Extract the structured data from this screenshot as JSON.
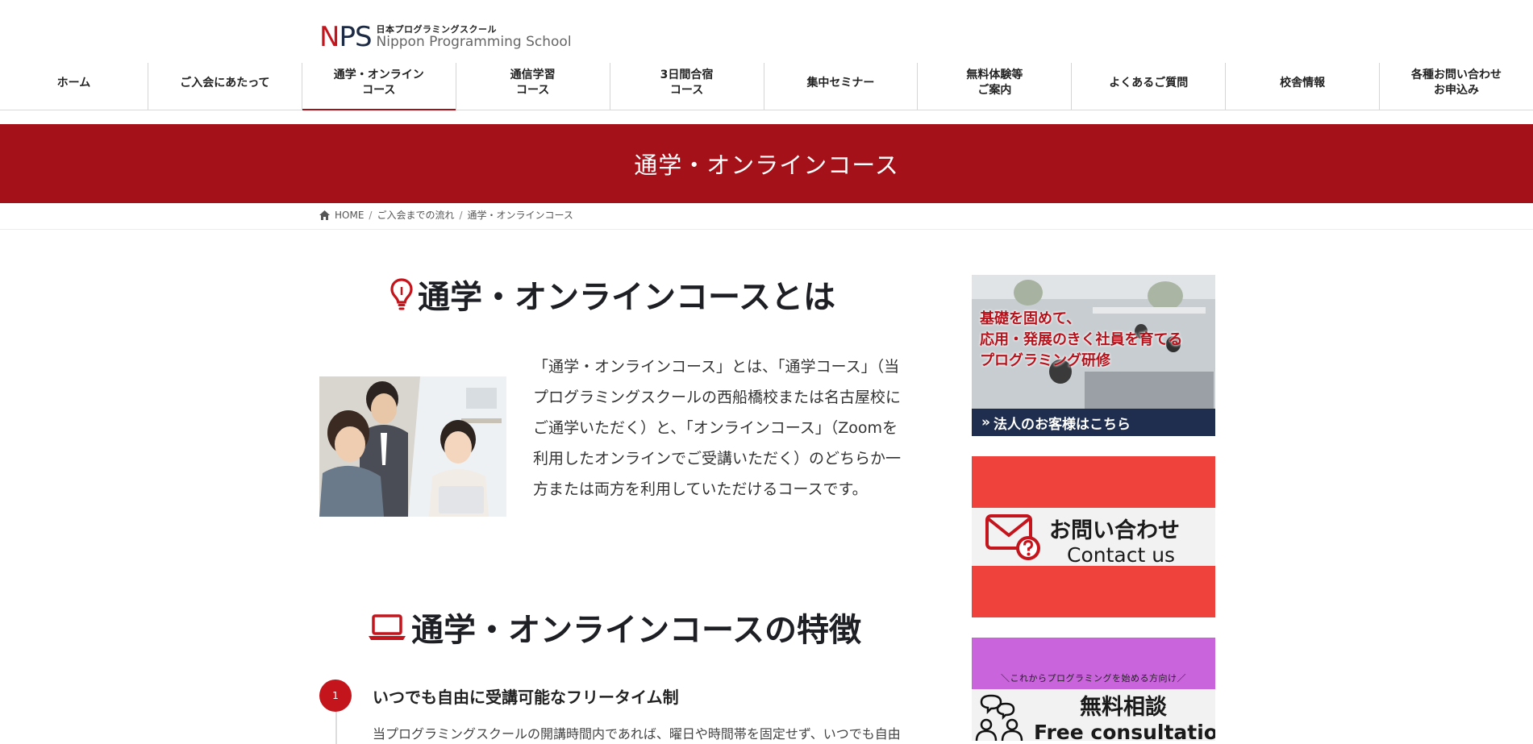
{
  "logo": {
    "mark_n": "N",
    "mark_ps": "PS",
    "name_jp": "日本プログラミングスクール",
    "name_en": "Nippon Programming School"
  },
  "nav": {
    "items": [
      {
        "label": "ホーム"
      },
      {
        "label": "ご入会にあたって"
      },
      {
        "label": "通学・オンライン\nコース"
      },
      {
        "label": "通信学習\nコース"
      },
      {
        "label": "3日間合宿\nコース"
      },
      {
        "label": "集中セミナー"
      },
      {
        "label": "無料体験等\nご案内"
      },
      {
        "label": "よくあるご質問"
      },
      {
        "label": "校舎情報"
      },
      {
        "label": "各種お問い合わせ\nお申込み"
      }
    ],
    "active_index": 2
  },
  "page": {
    "title": "通学・オンラインコース"
  },
  "breadcrumb": {
    "home": "HOME",
    "step1": "ご入会までの流れ",
    "current": "通学・オンラインコース",
    "separator": "/"
  },
  "section1": {
    "icon": "lightbulb-icon",
    "heading": "通学・オンラインコースとは",
    "body": "「通学・オンラインコース」とは、「通学コース」（当プログラミングスクールの西船橋校または名古屋校にご通学いただく）と、「オンラインコース」（Zoomを利用したオンラインでご受講いただく）のどちらか一方または両方を利用していただけるコースです。"
  },
  "section2": {
    "icon": "laptop-icon",
    "heading": "通学・オンラインコースの特徴",
    "feature1": {
      "number": "1",
      "title": "いつでも自由に受講可能なフリータイム制",
      "text": "当プログラミングスクールの開講時間内であれば、曜日や時間帯を固定せず、いつでも自由"
    }
  },
  "sidebar": {
    "corporate": {
      "line1": "基礎を固めて、",
      "line2": "応用・発展のきく社員を育てる",
      "line3": "プログラミング研修",
      "footer_arrow": "»",
      "footer": "法人のお客様はこちら"
    },
    "contact": {
      "title_jp": "お問い合わせ",
      "title_en": "Contact us"
    },
    "free_consult": {
      "subtitle": "＼これからプログラミングを始める方向け／",
      "title_jp": "無料相談",
      "title_en": "Free consultation"
    }
  },
  "colors": {
    "brand_red": "#a51119",
    "accent_red": "#c4141c",
    "contact_red": "#f0423d",
    "purple": "#c964dc",
    "navy": "#1f2d4e"
  }
}
